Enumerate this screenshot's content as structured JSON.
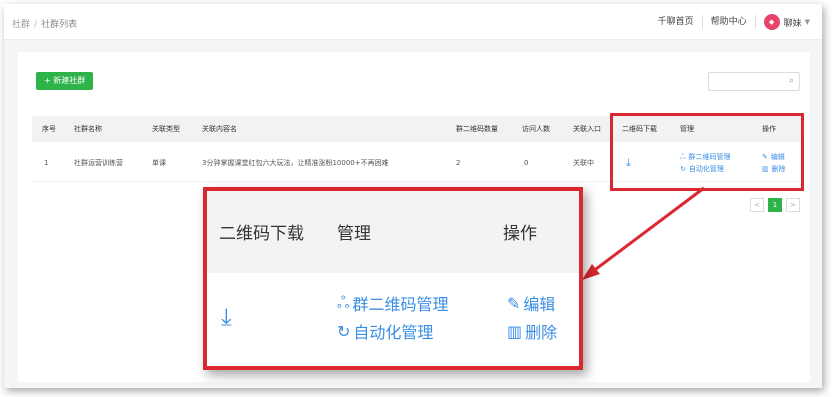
{
  "breadcrumb": {
    "root": "社群",
    "separator": "/",
    "current": "社群列表"
  },
  "topnav": {
    "links": [
      "千聊首页",
      "帮助中心"
    ],
    "user_name": "聊妹",
    "avatar_text": "◆"
  },
  "toolbar": {
    "new_button": "+ 新建社群",
    "search_placeholder": ""
  },
  "table": {
    "headers": [
      "序号",
      "社群名称",
      "关联类型",
      "关联内容名",
      "群二维码数量",
      "访问人数",
      "关联入口",
      "二维码下载",
      "管理",
      "操作"
    ],
    "rows": [
      {
        "index": "1",
        "name": "社群运营训练营",
        "type": "单课",
        "content": "3分钟掌握课堂红包六大玩法，让精准涨粉10000+不再困难",
        "qr_count": "2",
        "visitors": "0",
        "entry": "关联中",
        "download_icon": "⤓",
        "manage_qr": "群二维码管理",
        "manage_auto": "自动化管理",
        "op_edit": "编辑",
        "op_delete": "删除"
      }
    ]
  },
  "pagination": {
    "prev": "<",
    "current": "1",
    "next": ">"
  },
  "zoom": {
    "headers": [
      "二维码下载",
      "管理",
      "操作"
    ],
    "manage_qr": "群二维码管理",
    "manage_auto": "自动化管理",
    "op_edit": "编辑",
    "op_delete": "删除"
  },
  "colors": {
    "accent_green": "#2eb349",
    "link_blue": "#3a8ee6",
    "highlight_red": "#d9282f"
  }
}
